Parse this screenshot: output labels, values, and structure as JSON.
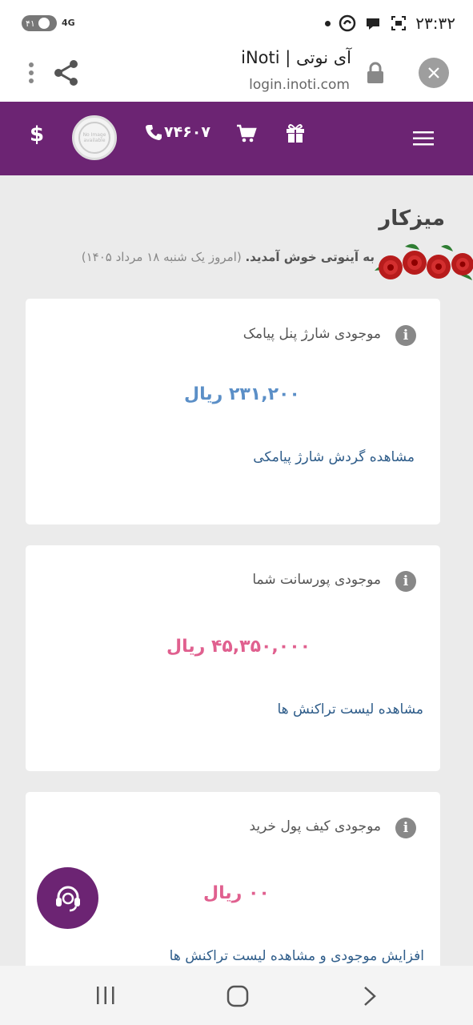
{
  "status_bar": {
    "battery": "۴۱",
    "network": "4G",
    "clock": "۲۳:۳۲"
  },
  "browser": {
    "title": "آی نوتی | iNoti",
    "url": "login.inoti.com",
    "close_icon": "close-icon",
    "lock_icon": "lock-icon",
    "share_icon": "share-icon",
    "more_icon": "more-vertical-icon"
  },
  "nav": {
    "dollar": "$",
    "phone": "۷۴۶۰۷",
    "avatar_text": "No Image available",
    "bg_color": "#6c2473"
  },
  "dashboard": {
    "title": "میزکار",
    "welcome_bold": "به آینوتی خوش آمدید.",
    "welcome_date": "(امروز یک شنبه ۱۸ مرداد ۱۴۰۵)"
  },
  "cards": [
    {
      "label": "موجودی شارژ پنل پیامک",
      "amount": "۲۳۱,۲۰۰ ریال",
      "amount_color": "#5b8fc7",
      "link": "مشاهده گردش شارژ پیامکی"
    },
    {
      "label": "موجودی پورسانت شما",
      "amount": "۴۵,۳۵۰,۰۰۰ ریال",
      "amount_color": "#e0608f",
      "link": "مشاهده لیست تراکنش ها"
    },
    {
      "label": "موجودی کیف پول خرید",
      "amount": "۰۰ ریال",
      "amount_color": "#e0608f",
      "link": "افزایش موجودی و مشاهده لیست تراکنش ها"
    }
  ]
}
